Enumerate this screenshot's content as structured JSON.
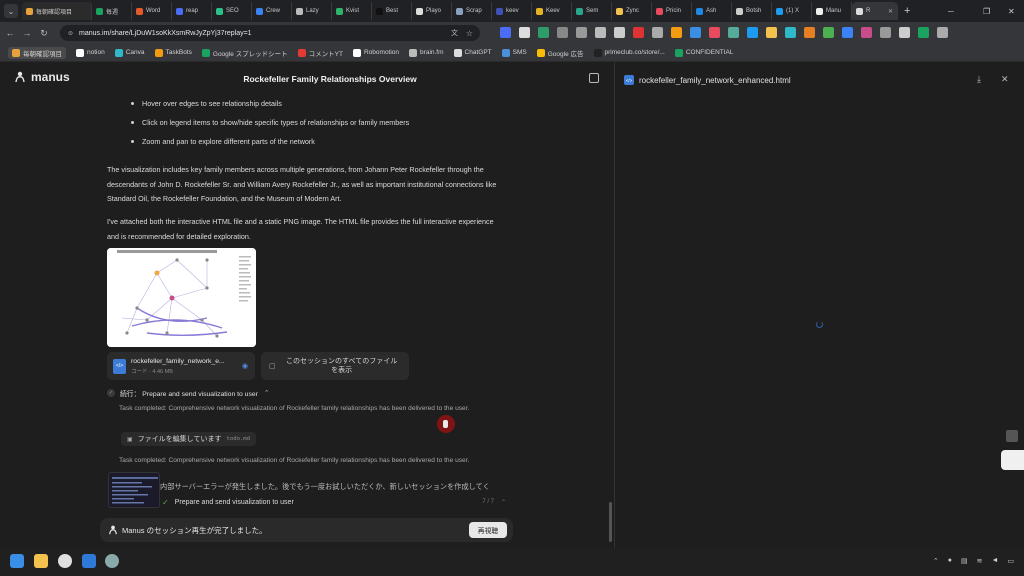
{
  "browser": {
    "tabs": [
      {
        "label": "毎朝確認項目",
        "color": "#e8a23b"
      },
      {
        "label": "毎週",
        "color": "#1aa260"
      },
      {
        "label": "Word",
        "color": "#e55a2b"
      },
      {
        "label": "reap",
        "color": "#4a6cf7"
      },
      {
        "label": "SEO",
        "color": "#2bbf8a"
      },
      {
        "label": "Crew",
        "color": "#3b82f6"
      },
      {
        "label": "Lazy",
        "color": "#bbbbbb"
      },
      {
        "label": "Kvist",
        "color": "#2fb36b"
      },
      {
        "label": "Best",
        "color": "#111111"
      },
      {
        "label": "Playo",
        "color": "#dddddd"
      },
      {
        "label": "Scrap",
        "color": "#8aa0c0"
      },
      {
        "label": "keev",
        "color": "#3f51b5"
      },
      {
        "label": "Keev",
        "color": "#e6b422"
      },
      {
        "label": "Sem",
        "color": "#2ca58d"
      },
      {
        "label": "Zync",
        "color": "#f2c14e"
      },
      {
        "label": "Pricin",
        "color": "#e84a5f"
      },
      {
        "label": "Ash",
        "color": "#1e88e5"
      },
      {
        "label": "Botsh",
        "color": "#cccccc"
      },
      {
        "label": "(1) X",
        "color": "#1d9bf0"
      },
      {
        "label": "Manu",
        "color": "#eeeeee"
      },
      {
        "label": "R",
        "color": "#dddddd",
        "active": true
      }
    ],
    "url": "manus.im/share/LjDuW1soKkXsmRwJyZpYj37replay=1",
    "bookmarks": [
      {
        "label": "毎朝確認項目",
        "folder": true,
        "color": "#e8a23b"
      },
      {
        "label": "notion",
        "color": "#ffffff"
      },
      {
        "label": "Canva",
        "color": "#2fb8c7"
      },
      {
        "label": "TaskBots",
        "color": "#f39c12"
      },
      {
        "label": "Google スプレッドシート",
        "color": "#1aa260"
      },
      {
        "label": "コメントYT",
        "color": "#e53935"
      },
      {
        "label": "Robomotion",
        "color": "#ffffff"
      },
      {
        "label": "brain.fm",
        "color": "#bbbbbb"
      },
      {
        "label": "ChatGPT",
        "color": "#dddddd"
      },
      {
        "label": "SMS",
        "color": "#4a90d9"
      },
      {
        "label": "Google 広告",
        "color": "#fbbc04"
      },
      {
        "label": "primeclub.co/store/...",
        "color": "#222222"
      },
      {
        "label": "CONFIDENTIAL",
        "color": "#1aa260"
      }
    ]
  },
  "app": {
    "logo": "manus",
    "title": "Rockefeller Family Relationships Overview",
    "bullets": [
      "Hover over edges to see relationship details",
      "Click on legend items to show/hide specific types of relationships or family members",
      "Zoom and pan to explore different parts of the network"
    ],
    "paragraphs": [
      "The visualization includes key family members across multiple generations, from Johann Peter Rockefeller through the descendants of John D. Rockefeller Sr. and William Avery Rockefeller Jr., as well as important institutional connections like Standard Oil, the Rockefeller Foundation, and the Museum of Modern Art.",
      "I've attached both the interactive HTML file and a static PNG image. The HTML file provides the full interactive experience and is recommended for detailed exploration."
    ],
    "file_card": {
      "name": "rockefeller_family_network_e...",
      "meta": "コード · 4.46 MB"
    },
    "all_files": "このセッションのすべてのファイルを表示",
    "step_header": "続行： Prepare and send visualization to user",
    "task1": "Task completed: Comprehensive network visualization of Rockefeller family relationships has been delivered to the user.",
    "editing_label": "ファイルを編集しています",
    "editing_file": "todo.md",
    "task2": "Task completed: Comprehensive network visualization of Rockefeller family relationships has been delivered to the user.",
    "error_text": "内部サーバーエラーが発生しました。後でもう一度お試しいただくか、新しいセッションを作成してく",
    "progress_label": "Prepare and send visualization to user",
    "progress_count": "7 / 7",
    "replay_text": "Manus のセッション再生が完了しました。",
    "replay_button": "再視聴"
  },
  "preview": {
    "filename": "rockefeller_family_network_enhanced.html"
  },
  "colors": {
    "accent": "#3d7bd9",
    "success": "#4caf50",
    "cursor": "#8b1414"
  }
}
